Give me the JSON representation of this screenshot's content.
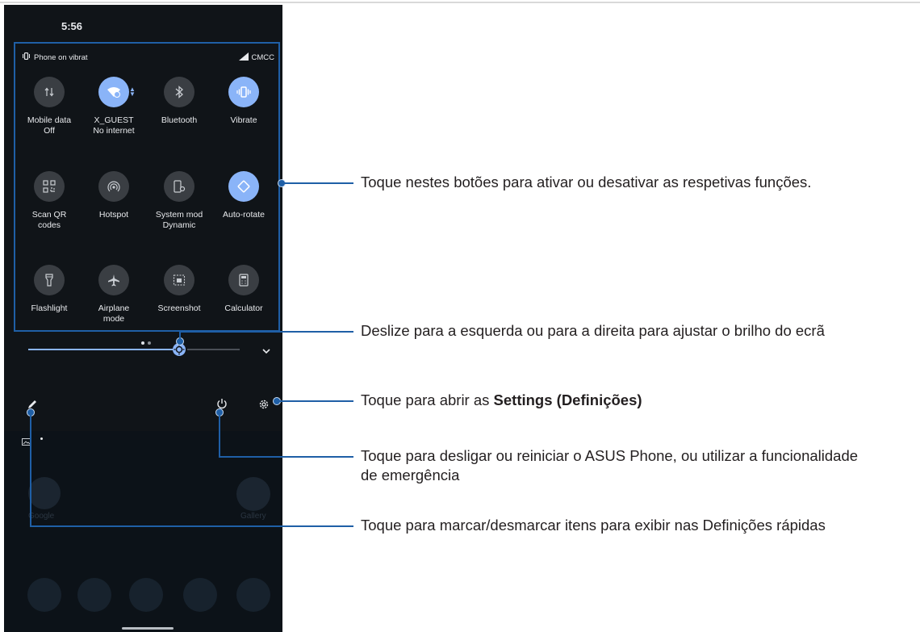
{
  "status": {
    "time": "5:56",
    "ringer": "Phone on vibrat",
    "carrier": "CMCC"
  },
  "tiles": [
    {
      "name": "mobile-data",
      "line1": "Mobile data",
      "line2": "Off",
      "on": false,
      "icon": "updown-arrows-icon"
    },
    {
      "name": "wifi",
      "line1": "X_GUEST",
      "line2": "No internet",
      "on": true,
      "icon": "wifi-icon"
    },
    {
      "name": "bluetooth",
      "line1": "Bluetooth",
      "line2": "",
      "on": false,
      "icon": "bluetooth-icon"
    },
    {
      "name": "vibrate",
      "line1": "Vibrate",
      "line2": "",
      "on": true,
      "icon": "vibrate-icon"
    },
    {
      "name": "scan-qr",
      "line1": "Scan QR",
      "line2": "codes",
      "on": false,
      "icon": "qr-code-icon"
    },
    {
      "name": "hotspot",
      "line1": "Hotspot",
      "line2": "",
      "on": false,
      "icon": "hotspot-icon"
    },
    {
      "name": "system-mode",
      "line1": "System mod",
      "line2": "Dynamic",
      "on": false,
      "icon": "system-mode-icon"
    },
    {
      "name": "auto-rotate",
      "line1": "Auto-rotate",
      "line2": "",
      "on": true,
      "icon": "rotate-icon"
    },
    {
      "name": "flashlight",
      "line1": "Flashlight",
      "line2": "",
      "on": false,
      "icon": "flashlight-icon"
    },
    {
      "name": "airplane",
      "line1": "Airplane",
      "line2": "mode",
      "on": false,
      "icon": "airplane-icon"
    },
    {
      "name": "screenshot",
      "line1": "Screenshot",
      "line2": "",
      "on": false,
      "icon": "screenshot-icon"
    },
    {
      "name": "calculator",
      "line1": "Calculator",
      "line2": "",
      "on": false,
      "icon": "calculator-icon"
    }
  ],
  "brightness": {
    "level": 0.65
  },
  "home": {
    "folder_label": "Google",
    "gallery_label": "Gallery"
  },
  "callouts": {
    "tiles": "Toque nestes botões para ativar ou desativar as respetivas funções.",
    "brightness": "Deslize para a esquerda ou para a direita para ajustar o brilho do ecrã",
    "settings_prefix": "Toque para abrir as ",
    "settings_bold": "Settings (Definições)",
    "power": "Toque para desligar ou reiniciar o ASUS Phone, ou utilizar a funcionalidade de emergência",
    "edit": "Toque para marcar/desmarcar itens para exibir nas Definições rápidas"
  },
  "colors": {
    "accent": "#8ab4f8",
    "callout_line": "#1f5fa6",
    "panel_bg": "#101418"
  }
}
